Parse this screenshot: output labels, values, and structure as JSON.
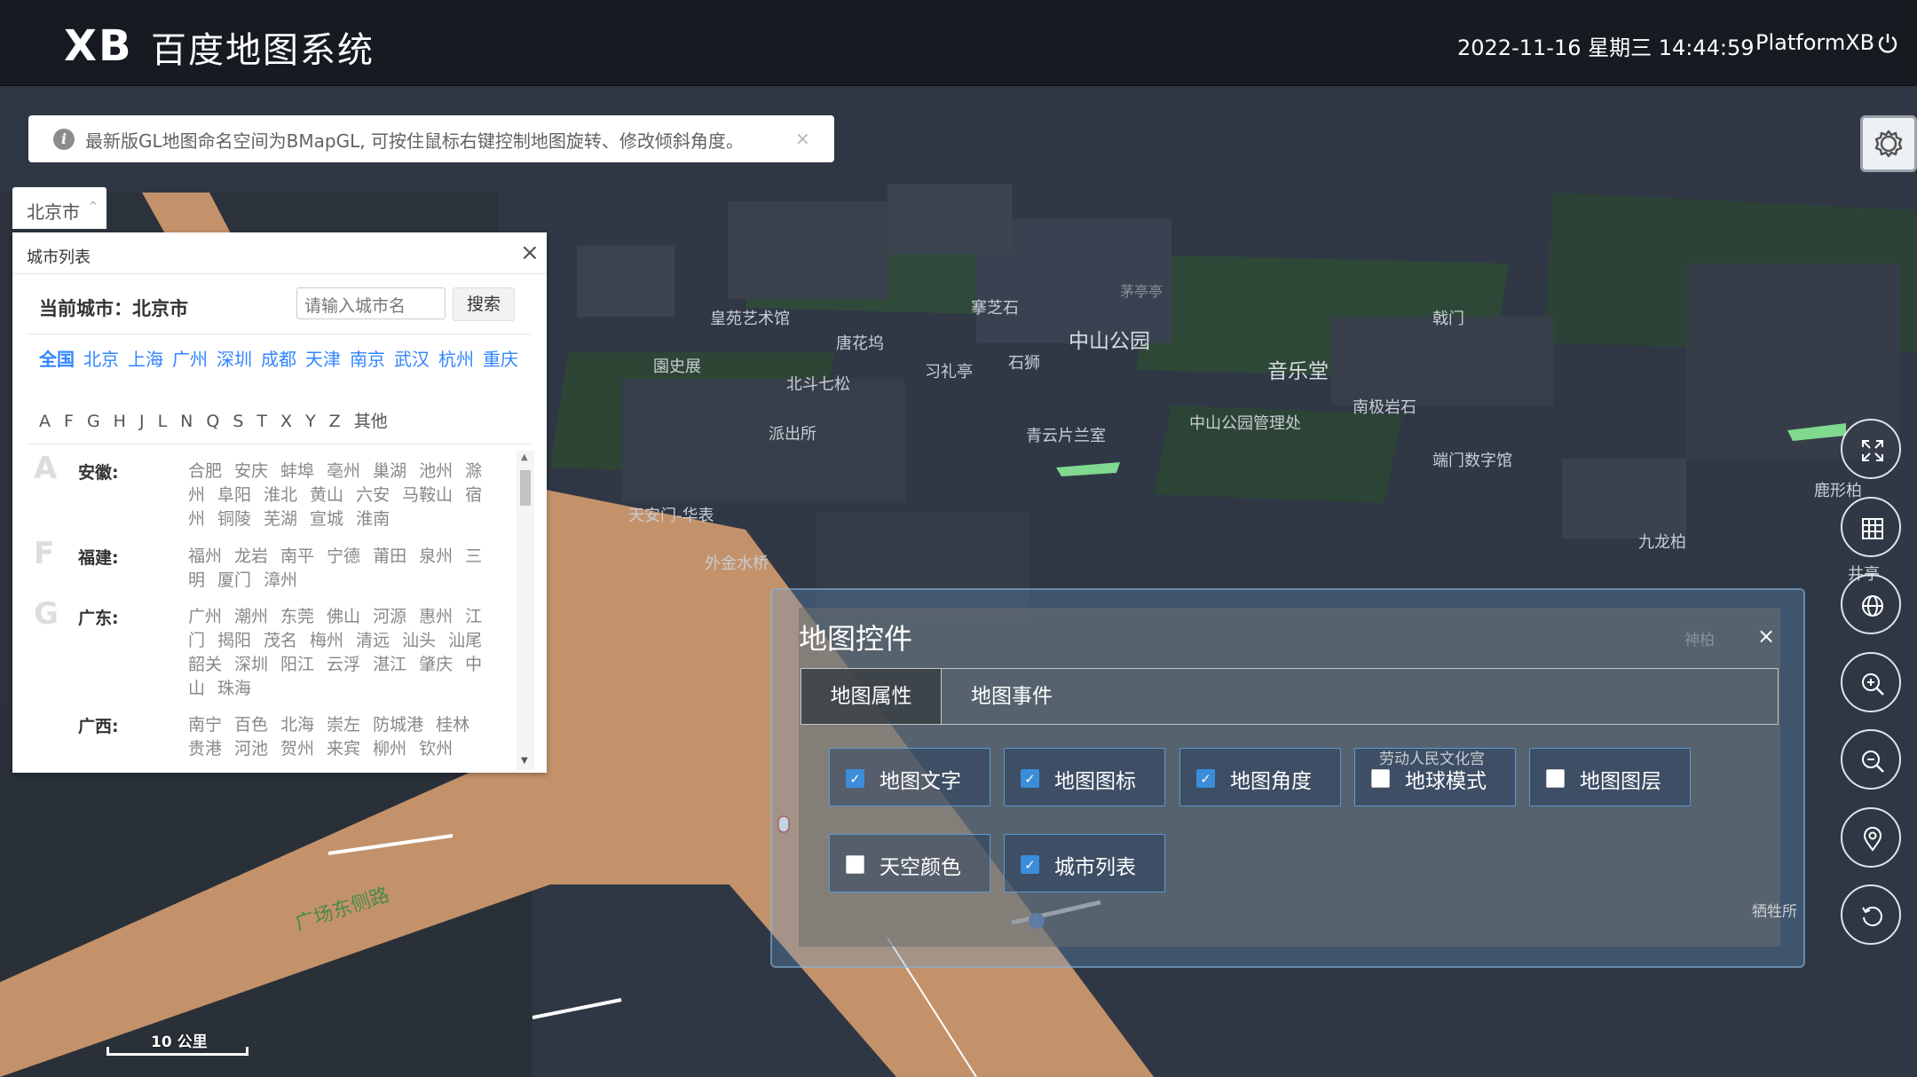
{
  "header": {
    "logo": "XB",
    "title": "百度地图系统",
    "datetime": "2022-11-16 星期三 14:44:59",
    "user": "PlatformXB",
    "power_icon": "power-icon"
  },
  "notice": {
    "text": "最新版GL地图命名空间为BMapGL, 可按住鼠标右键控制地图旋转、修改倾斜角度。",
    "close": "×"
  },
  "city_tab": {
    "label": "北京市",
    "caret": "^"
  },
  "city_panel": {
    "title": "城市列表",
    "close": "×",
    "current_label": "当前城市：北京市",
    "search_placeholder": "请输入城市名",
    "search_button": "搜索",
    "hot_cities": [
      "全国",
      "北京",
      "上海",
      "广州",
      "深圳",
      "成都",
      "天津",
      "南京",
      "武汉",
      "杭州",
      "重庆"
    ],
    "letters": [
      "A",
      "F",
      "G",
      "H",
      "J",
      "L",
      "N",
      "Q",
      "S",
      "T",
      "X",
      "Y",
      "Z",
      "其他"
    ],
    "provinces": [
      {
        "letter": "A",
        "name": "安徽:",
        "cities": [
          "合肥",
          "安庆",
          "蚌埠",
          "亳州",
          "巢湖",
          "池州",
          "滁州",
          "阜阳",
          "淮北",
          "黄山",
          "六安",
          "马鞍山",
          "宿州",
          "铜陵",
          "芜湖",
          "宣城",
          "淮南"
        ]
      },
      {
        "letter": "F",
        "name": "福建:",
        "cities": [
          "福州",
          "龙岩",
          "南平",
          "宁德",
          "莆田",
          "泉州",
          "三明",
          "厦门",
          "漳州"
        ]
      },
      {
        "letter": "G",
        "name": "广东:",
        "cities": [
          "广州",
          "潮州",
          "东莞",
          "佛山",
          "河源",
          "惠州",
          "江门",
          "揭阳",
          "茂名",
          "梅州",
          "清远",
          "汕头",
          "汕尾",
          "韶关",
          "深圳",
          "阳江",
          "云浮",
          "湛江",
          "肇庆",
          "中山",
          "珠海"
        ]
      },
      {
        "letter": "",
        "name": "广西:",
        "cities": [
          "南宁",
          "百色",
          "北海",
          "崇左",
          "防城港",
          "桂林",
          "贵港",
          "河池",
          "贺州",
          "来宾",
          "柳州",
          "钦州"
        ]
      }
    ]
  },
  "map_labels": [
    {
      "text": "皇苑艺术馆",
      "big": false
    },
    {
      "text": "唐花坞",
      "big": false
    },
    {
      "text": "園史展",
      "big": false
    },
    {
      "text": "北斗七松",
      "big": false
    },
    {
      "text": "习礼亭",
      "big": false
    },
    {
      "text": "石狮",
      "big": false
    },
    {
      "text": "搴芝石",
      "big": false
    },
    {
      "text": "茅亭亭",
      "big": false
    },
    {
      "text": "中山公园",
      "big": true
    },
    {
      "text": "戟门",
      "big": false
    },
    {
      "text": "音乐堂",
      "big": true
    },
    {
      "text": "南极岩石",
      "big": false
    },
    {
      "text": "中山公园管理处",
      "big": false
    },
    {
      "text": "派出所",
      "big": false
    },
    {
      "text": "青云片兰室",
      "big": false
    },
    {
      "text": "端门数字馆",
      "big": false
    },
    {
      "text": "天安门-华表",
      "big": false
    },
    {
      "text": "外金水桥",
      "big": false
    },
    {
      "text": "鹿形柏",
      "big": false
    },
    {
      "text": "九龙柏",
      "big": false
    },
    {
      "text": "井亭",
      "big": false
    },
    {
      "text": "神柏",
      "big": false
    },
    {
      "text": "劳动人民文化宫",
      "big": false
    },
    {
      "text": "牺牲所",
      "big": false
    },
    {
      "text": "广场东侧路",
      "big": false
    }
  ],
  "control_panel": {
    "title": "地图控件",
    "close": "×",
    "tabs": [
      "地图属性",
      "地图事件"
    ],
    "options": [
      {
        "label": "地图文字",
        "checked": true
      },
      {
        "label": "地图图标",
        "checked": true
      },
      {
        "label": "地图角度",
        "checked": true
      },
      {
        "label": "地球模式",
        "checked": false
      },
      {
        "label": "地图图层",
        "checked": false
      },
      {
        "label": "天空颜色",
        "checked": false
      },
      {
        "label": "城市列表",
        "checked": true
      }
    ]
  },
  "right_buttons": [
    "fullscreen-icon",
    "grid-layer-icon",
    "globe-icon",
    "zoom-in-icon",
    "zoom-out-icon",
    "location-icon",
    "reset-rotate-icon"
  ],
  "scale": {
    "text": "10 公里"
  },
  "colors": {
    "header_bg": "#161b22",
    "road": "#c4926a",
    "accent": "#3385ff",
    "map_bg": "#2f3745"
  }
}
